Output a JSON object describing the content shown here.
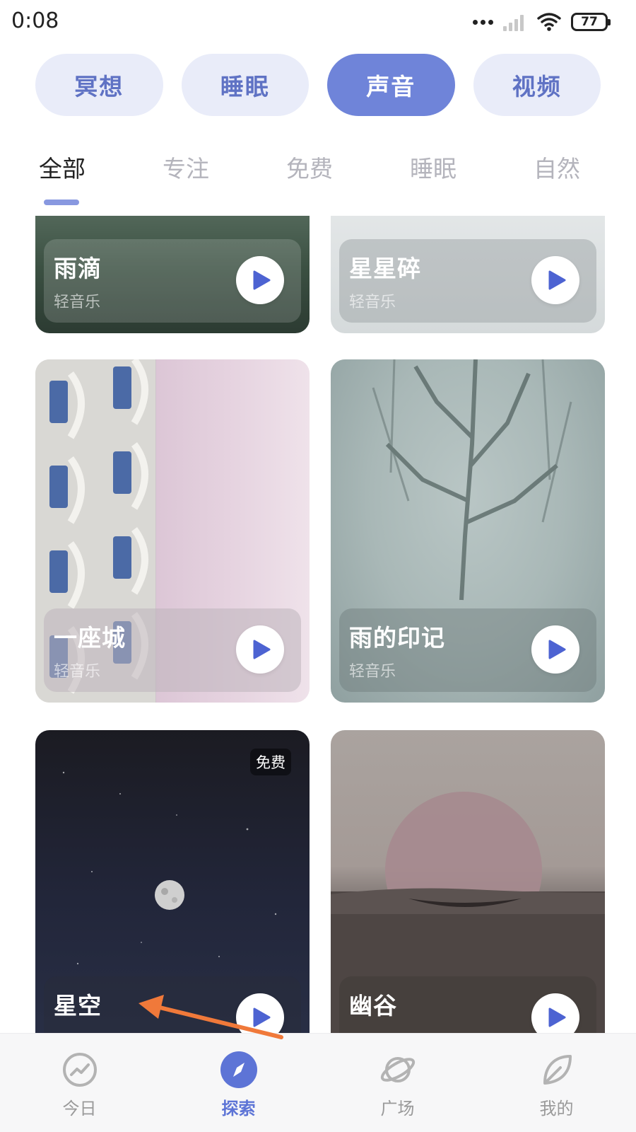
{
  "status_bar": {
    "time": "0:08",
    "battery": "77"
  },
  "categories": [
    {
      "label": "冥想",
      "active": false
    },
    {
      "label": "睡眠",
      "active": false
    },
    {
      "label": "声音",
      "active": true
    },
    {
      "label": "视频",
      "active": false
    }
  ],
  "sub_tabs": [
    {
      "label": "全部",
      "active": true
    },
    {
      "label": "专注",
      "active": false
    },
    {
      "label": "免费",
      "active": false
    },
    {
      "label": "睡眠",
      "active": false
    },
    {
      "label": "自然",
      "active": false
    }
  ],
  "cards": [
    {
      "title": "雨滴",
      "subtitle": "轻音乐"
    },
    {
      "title": "星星碎",
      "subtitle": "轻音乐"
    },
    {
      "title": "一座城",
      "subtitle": "轻音乐"
    },
    {
      "title": "雨的印记",
      "subtitle": "轻音乐"
    },
    {
      "title": "星空",
      "subtitle": "",
      "badge": "免费"
    },
    {
      "title": "幽谷",
      "subtitle": ""
    }
  ],
  "bottom_nav": [
    {
      "label": "今日",
      "icon": "trend-icon",
      "active": false
    },
    {
      "label": "探索",
      "icon": "compass-icon",
      "active": true
    },
    {
      "label": "广场",
      "icon": "planet-icon",
      "active": false
    },
    {
      "label": "我的",
      "icon": "leaf-icon",
      "active": false
    }
  ],
  "colors": {
    "accent": "#6f84d9",
    "pill_bg": "#e9ecf9",
    "pill_text": "#5f72c4",
    "annotation_arrow": "#f0793a"
  }
}
